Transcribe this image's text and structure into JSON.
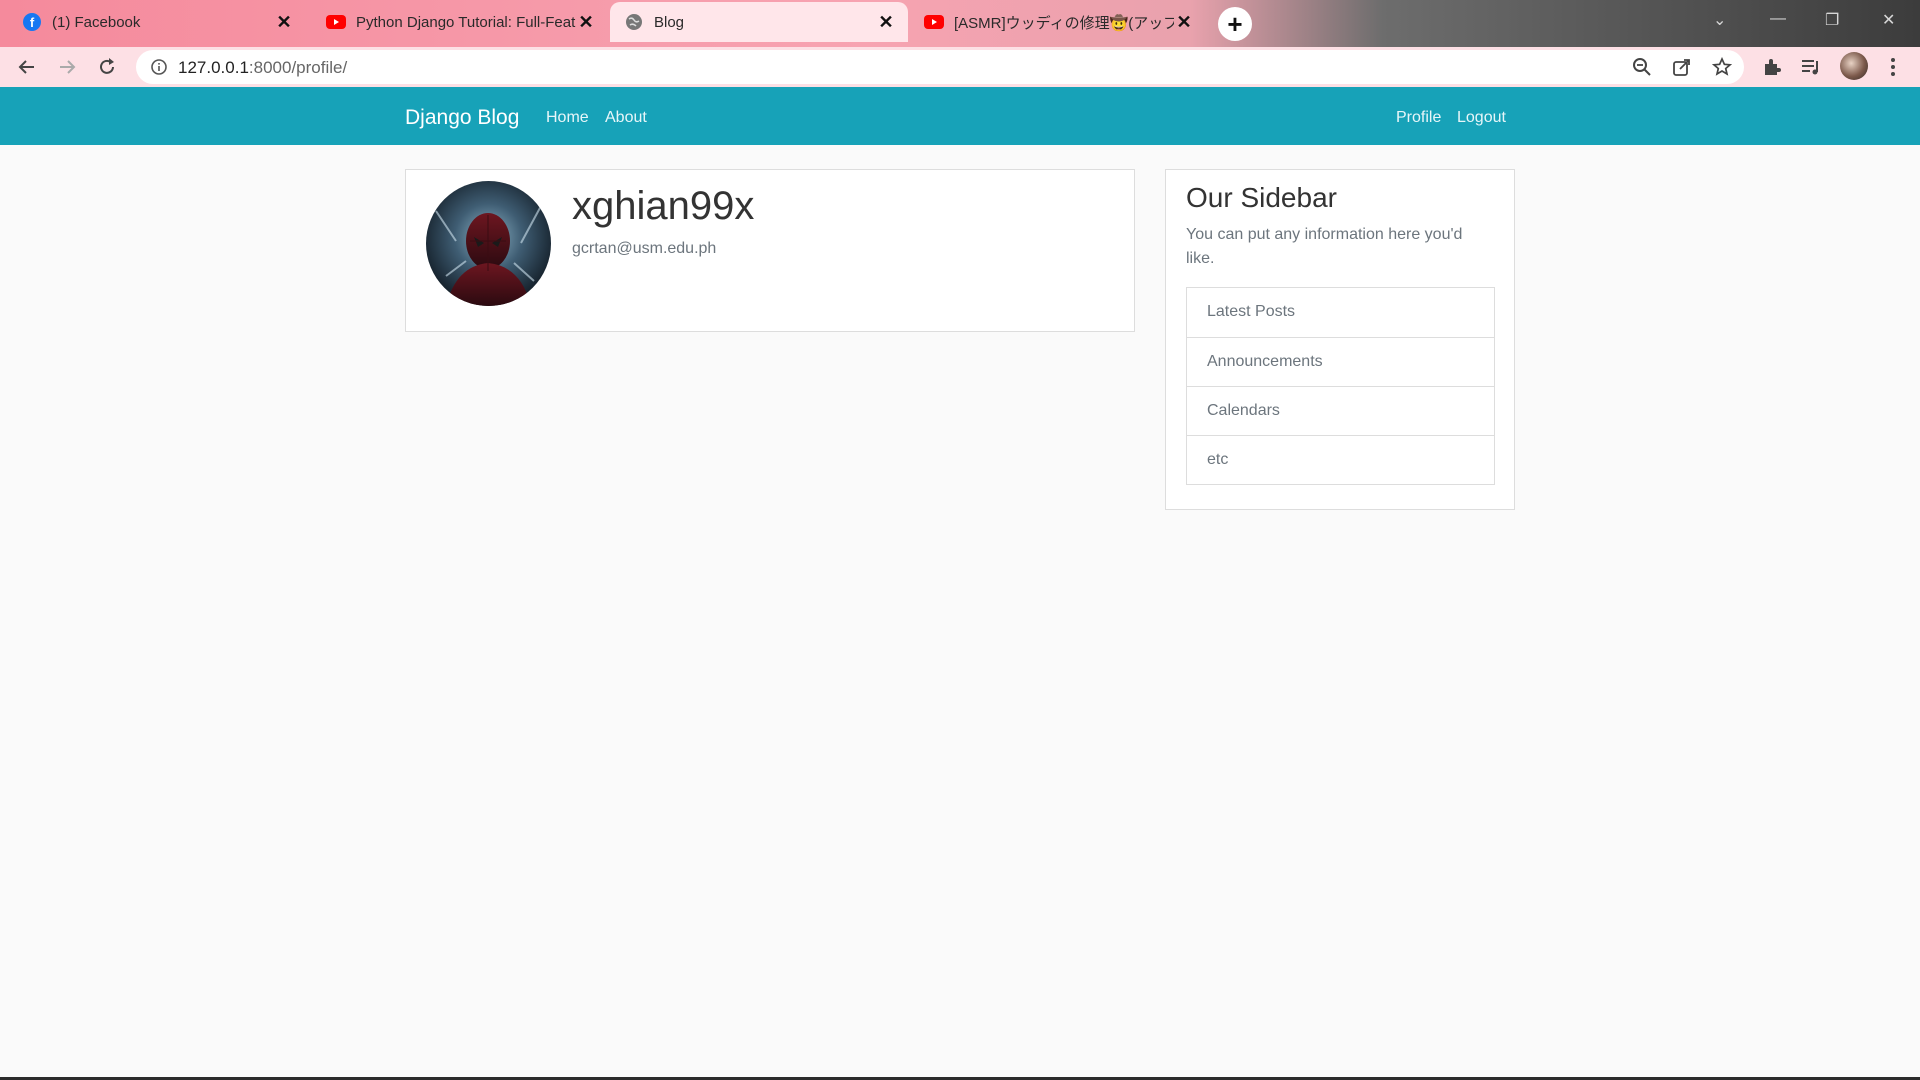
{
  "browser": {
    "tabs": [
      {
        "title": "(1) Facebook",
        "icon": "facebook-icon"
      },
      {
        "title": "Python Django Tutorial: Full-Featured",
        "icon": "youtube-icon"
      },
      {
        "title": "Blog",
        "icon": "globe-icon"
      },
      {
        "title": "[ASMR]ウッディの修理🤠(アップグレード",
        "icon": "youtube-icon"
      }
    ],
    "active_tab": 2,
    "url_host": "127.0.0.1",
    "url_path": ":8000/profile/"
  },
  "site": {
    "brand": "Django Blog",
    "nav_left": [
      "Home",
      "About"
    ],
    "nav_right": [
      "Profile",
      "Logout"
    ],
    "brand_color": "#17a2b8"
  },
  "profile": {
    "username": "xghian99x",
    "email": "gcrtan@usm.edu.ph"
  },
  "sidebar": {
    "title": "Our Sidebar",
    "text": "You can put any information here you'd like.",
    "items": [
      "Latest Posts",
      "Announcements",
      "Calendars",
      "etc"
    ]
  }
}
